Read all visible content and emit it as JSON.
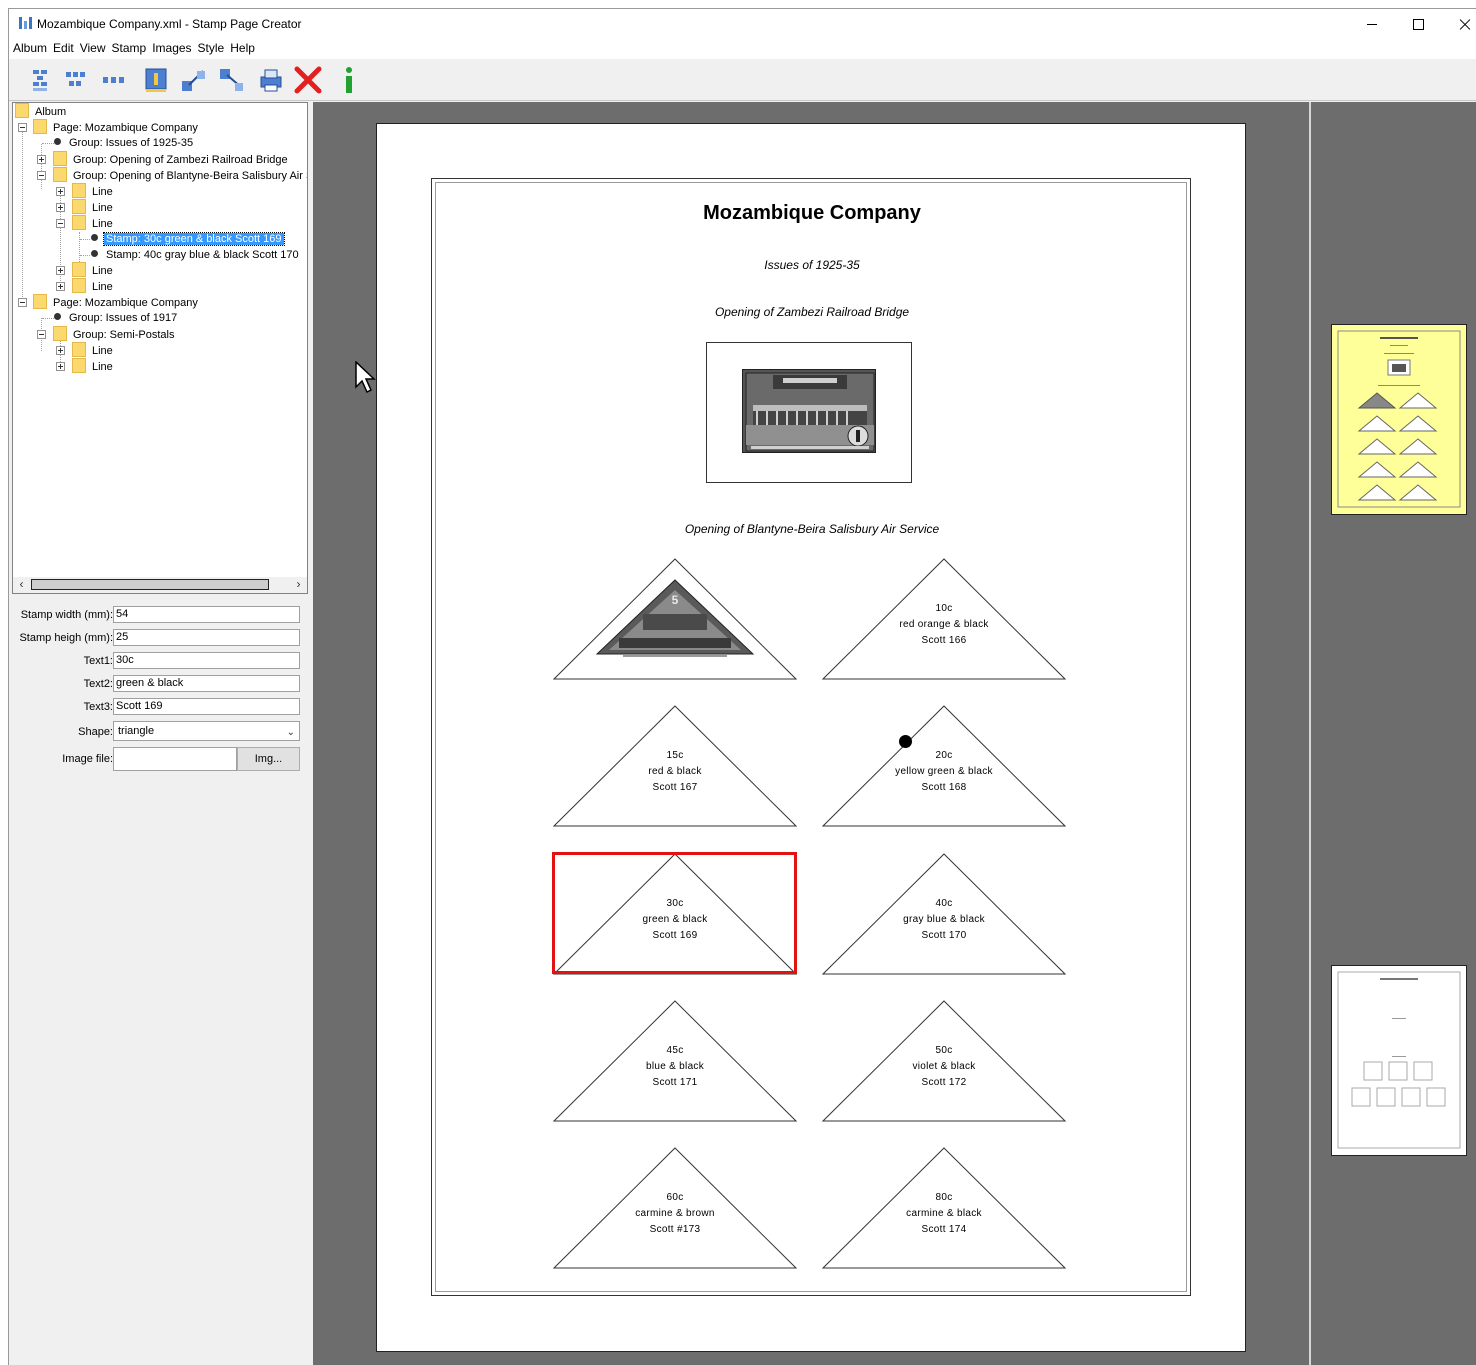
{
  "window": {
    "title": "Mozambique Company.xml - Stamp Page Creator"
  },
  "menu": [
    "Album",
    "Edit",
    "View",
    "Stamp",
    "Images",
    "Style",
    "Help"
  ],
  "toolbar": {
    "icons": [
      "add-page-icon",
      "add-group-icon",
      "add-line-icon",
      "add-stamp-icon",
      "move-up-icon",
      "move-down-icon",
      "print-icon",
      "delete-icon",
      "info-icon"
    ]
  },
  "tree": {
    "nodes": [
      {
        "label": "Album",
        "icon": "folder"
      },
      {
        "label": "Page: Mozambique Company",
        "icon": "folder"
      },
      {
        "label": "Group: Issues of 1925-35",
        "icon": "bullet"
      },
      {
        "label": "Group: Opening of Zambezi Railroad Bridge",
        "icon": "folder"
      },
      {
        "label": "Group: Opening of Blantyne-Beira Salisbury Air Se",
        "icon": "folder"
      },
      {
        "label": "Line",
        "icon": "folder"
      },
      {
        "label": "Line",
        "icon": "folder"
      },
      {
        "label": "Line",
        "icon": "folder"
      },
      {
        "label": "Stamp: 30c green & black Scott 169",
        "icon": "bullet",
        "selected": true
      },
      {
        "label": "Stamp: 40c gray blue & black Scott 170",
        "icon": "bullet"
      },
      {
        "label": "Line",
        "icon": "folder"
      },
      {
        "label": "Line",
        "icon": "folder"
      },
      {
        "label": "Page: Mozambique Company",
        "icon": "folder"
      },
      {
        "label": "Group: Issues of 1917",
        "icon": "bullet"
      },
      {
        "label": "Group: Semi-Postals",
        "icon": "folder"
      },
      {
        "label": "Line",
        "icon": "folder"
      },
      {
        "label": "Line",
        "icon": "folder"
      }
    ]
  },
  "properties": {
    "stamp_width_label": "Stamp width (mm):",
    "stamp_width": "54",
    "stamp_height_label": "Stamp heigh (mm):",
    "stamp_height": "25",
    "text1_label": "Text1:",
    "text1": "30c",
    "text2_label": "Text2:",
    "text2": "green & black",
    "text3_label": "Text3:",
    "text3": "Scott 169",
    "shape_label": "Shape:",
    "shape": "triangle",
    "image_file_label": "Image file:",
    "image_file": "",
    "img_button": "Img..."
  },
  "page": {
    "title": "Mozambique Company",
    "group1": "Issues of 1925-35",
    "group2": "Opening of Zambezi Railroad Bridge",
    "group3": "Opening of Blantyne-Beira Salisbury Air Service",
    "stamps": [
      {
        "t1": "",
        "t2": "",
        "t3": "",
        "image": true
      },
      {
        "t1": "10c",
        "t2": "red orange & black",
        "t3": "Scott 166"
      },
      {
        "t1": "15c",
        "t2": "red & black",
        "t3": "Scott 167"
      },
      {
        "t1": "20c",
        "t2": "yellow green  & black",
        "t3": "Scott 168"
      },
      {
        "t1": "30c",
        "t2": "green & black",
        "t3": "Scott 169",
        "selected": true
      },
      {
        "t1": "40c",
        "t2": "gray blue & black",
        "t3": "Scott 170"
      },
      {
        "t1": "45c",
        "t2": "blue & black",
        "t3": "Scott 171"
      },
      {
        "t1": "50c",
        "t2": "violet & black",
        "t3": "Scott 172"
      },
      {
        "t1": "60c",
        "t2": "carmine & brown",
        "t3": "Scott #173"
      },
      {
        "t1": "80c",
        "t2": "carmine & black",
        "t3": "Scott 174"
      }
    ]
  },
  "colors": {
    "selection": "#e31212",
    "tree_selection": "#3399ff",
    "canvas_bg": "#6d6d6d",
    "thumbnail_active": "#ffff99"
  }
}
